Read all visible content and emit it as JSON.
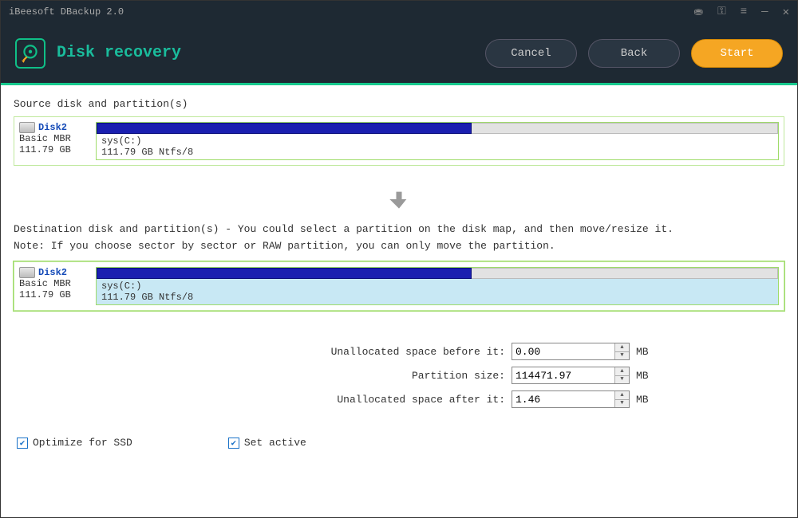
{
  "titlebar": {
    "title": "iBeesoft DBackup 2.0"
  },
  "header": {
    "page_title": "Disk recovery",
    "cancel": "Cancel",
    "back": "Back",
    "start": "Start"
  },
  "source": {
    "label": "Source disk and partition(s)",
    "disk": {
      "name": "Disk2",
      "type": "Basic MBR",
      "size": "111.79 GB",
      "part_label": "sys(C:)",
      "part_detail": "111.79 GB Ntfs/8"
    }
  },
  "destination": {
    "label": "Destination disk and partition(s) - You could select a partition on the disk map, and then move/resize it.",
    "note": "Note: If you choose sector by sector or RAW partition, you can only move the partition.",
    "disk": {
      "name": "Disk2",
      "type": "Basic MBR",
      "size": "111.79 GB",
      "part_label": "sys(C:)",
      "part_detail": "111.79 GB Ntfs/8"
    }
  },
  "form": {
    "before_label": "Unallocated space before it:",
    "before_value": "0.00",
    "size_label": "Partition size:",
    "size_value": "114471.97",
    "after_label": "Unallocated space after it:",
    "after_value": "1.46",
    "unit": "MB"
  },
  "options": {
    "ssd": "Optimize for SSD",
    "active": "Set active"
  }
}
